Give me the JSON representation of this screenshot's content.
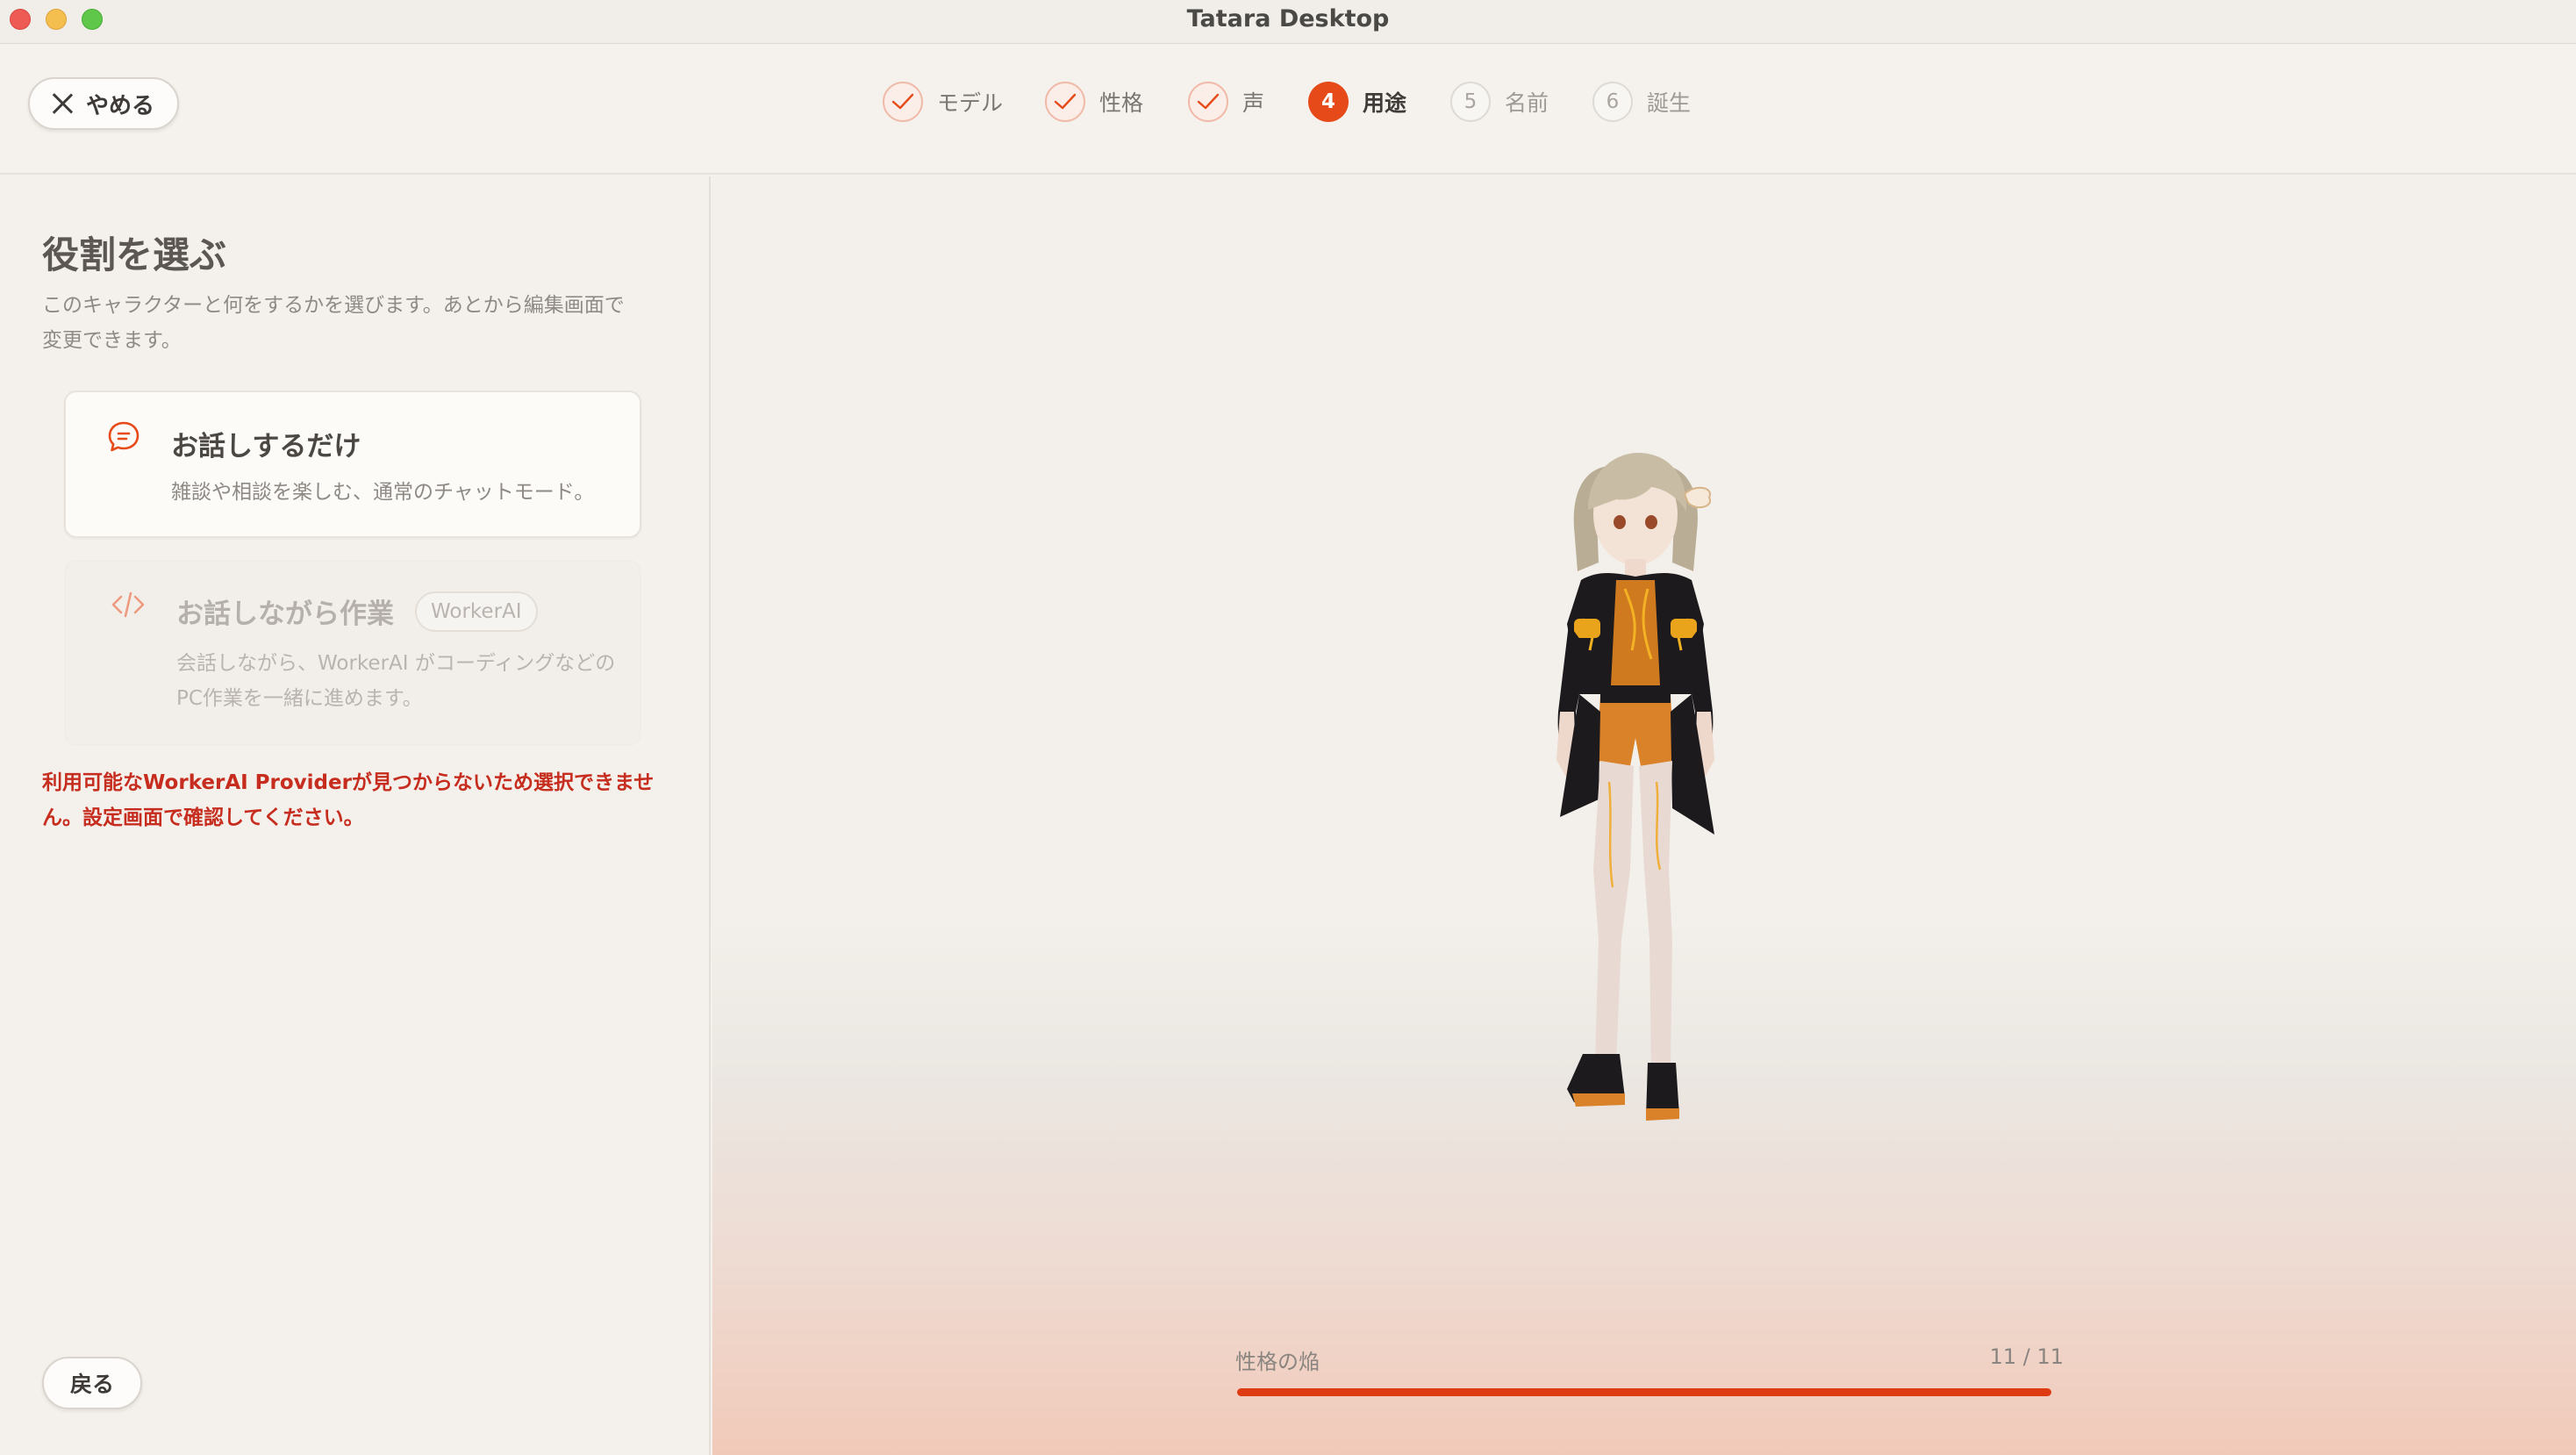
{
  "window": {
    "title": "Tatara Desktop"
  },
  "header": {
    "quit_label": "やめる",
    "steps": [
      {
        "label": "モデル",
        "state": "done"
      },
      {
        "label": "性格",
        "state": "done"
      },
      {
        "label": "声",
        "state": "done"
      },
      {
        "number": "4",
        "label": "用途",
        "state": "current"
      },
      {
        "number": "5",
        "label": "名前",
        "state": "todo"
      },
      {
        "number": "6",
        "label": "誕生",
        "state": "todo"
      }
    ]
  },
  "panel": {
    "title": "役割を選ぶ",
    "description": "このキャラクターと何をするかを選びます。あとから編集画面で変更できます。",
    "options": [
      {
        "title": "お話しするだけ",
        "description": "雑談や相談を楽しむ、通常のチャットモード。",
        "icon": "chat-bubble-icon",
        "enabled": true
      },
      {
        "title": "お話しながら作業",
        "badge": "WorkerAI",
        "description": "会話しながら、WorkerAI がコーディングなどのPC作業を一緒に進めます。",
        "icon": "code-icon",
        "enabled": false
      }
    ],
    "error": "利用可能なWorkerAI Providerが見つからないため選択できません。設定画面で確認してください。",
    "back_label": "戻る"
  },
  "preview": {
    "progress_label": "性格の焔",
    "progress_count": "11 / 11",
    "progress_fraction": 1.0
  },
  "colors": {
    "accent": "#e64a19",
    "error": "#c62d1e"
  }
}
